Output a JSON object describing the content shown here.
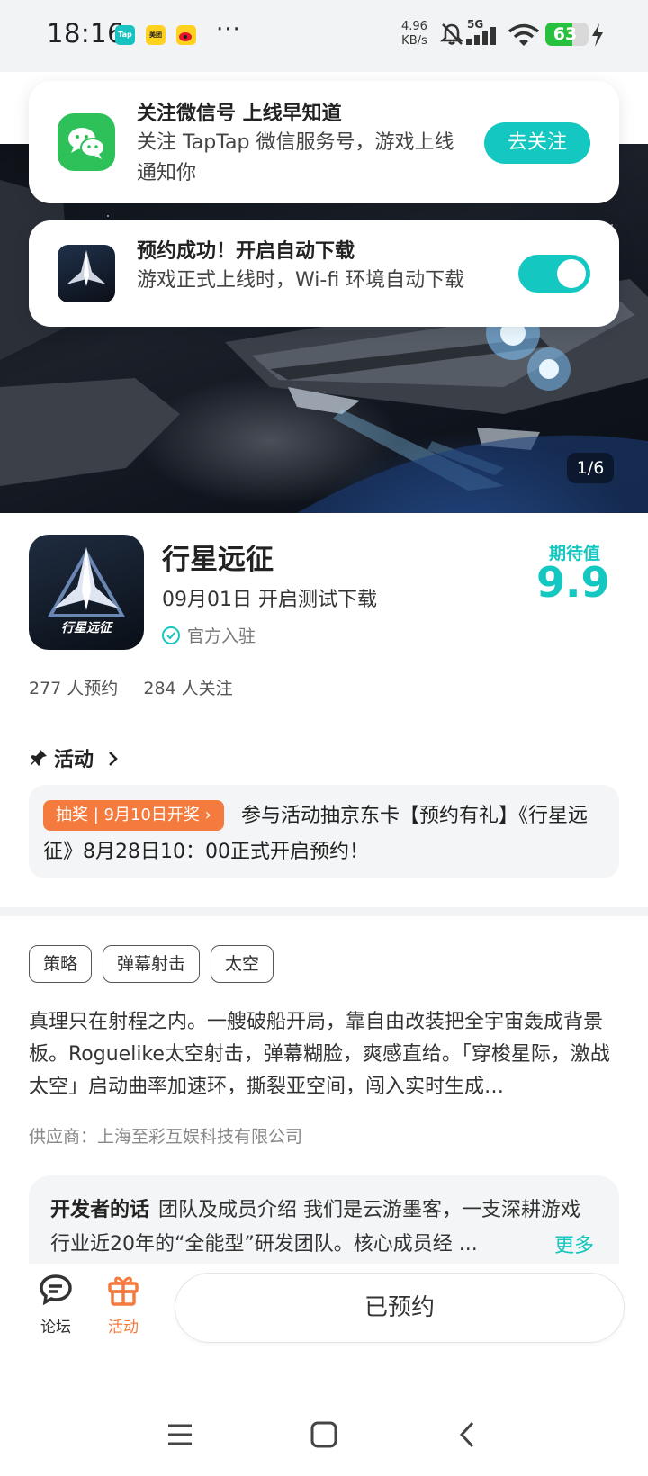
{
  "status_bar": {
    "time": "18:16",
    "apps": [
      "Tap",
      "美团",
      "微博"
    ],
    "more": "···",
    "speed_value": "4.96",
    "speed_unit": "KB/s",
    "network": "5G",
    "battery": "63",
    "battery_level": 0.63
  },
  "notifications": {
    "wechat": {
      "title": "关注微信号 上线早知道",
      "subtitle": "关注 TapTap 微信服务号，游戏上线通知你",
      "button": "去关注"
    },
    "auto_download": {
      "title": "预约成功！开启自动下载",
      "subtitle": "游戏正式上线时，Wi-fi 环境自动下载",
      "enabled": true
    }
  },
  "hero": {
    "counter": "1/6"
  },
  "game": {
    "name": "行星远征",
    "release": "09月01日 开启测试下载",
    "official": "官方入驻",
    "expect_label": "期待值",
    "expect_score": "9.9",
    "reservations": "277 人预约",
    "followers": "284 人关注",
    "icon_text": "行星远征"
  },
  "activity": {
    "header": "活动",
    "badge": "抽奖 | 9月10日开奖 ›",
    "text": "参与活动抽京东卡【预约有礼】《行星远征》8月28日10：00正式开启预约！"
  },
  "tags": [
    "策略",
    "弹幕射击",
    "太空"
  ],
  "description": "真理只在射程之内。一艘破船开局，靠自由改装把全宇宙轰成背景板。Roguelike太空射击，弹幕糊脸，爽感直给。「穿梭星际，激战太空」启动曲率加速环，撕裂亚空间，闯入实时生成…",
  "supplier": "供应商：上海至彩互娱科技有限公司",
  "developer": {
    "title": "开发者的话",
    "text": "团队及成员介绍 我们是云游墨客，一支深耕游戏行业近20年的“全能型”研发团队。核心成员经 ...",
    "more": "更多"
  },
  "bottom_bar": {
    "forum": "论坛",
    "activity": "活动",
    "reserved": "已预约"
  },
  "colors": {
    "accent": "#14c7c0",
    "orange": "#f57a3d",
    "wechat_green": "#2ec15a"
  }
}
